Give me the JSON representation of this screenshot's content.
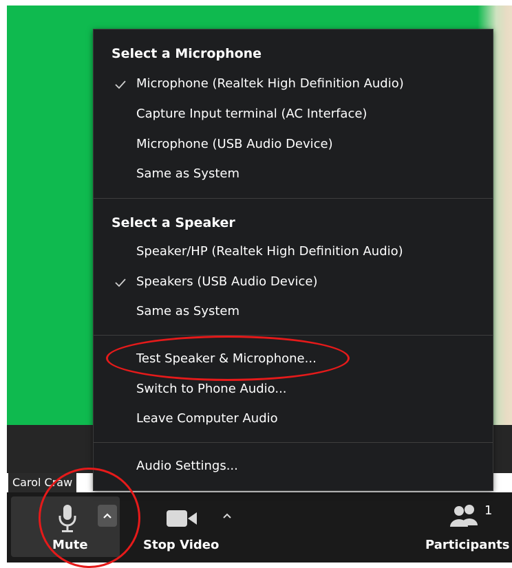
{
  "video": {
    "participant_name": "Carol Craw"
  },
  "menu": {
    "microphone_section": {
      "title": "Select a Microphone",
      "items": [
        {
          "label": "Microphone (Realtek High Definition Audio)",
          "checked": true
        },
        {
          "label": "Capture Input terminal (AC Interface)",
          "checked": false
        },
        {
          "label": "Microphone (USB Audio Device)",
          "checked": false
        },
        {
          "label": "Same as System",
          "checked": false
        }
      ]
    },
    "speaker_section": {
      "title": "Select a Speaker",
      "items": [
        {
          "label": "Speaker/HP (Realtek High Definition Audio)",
          "checked": false
        },
        {
          "label": "Speakers (USB Audio Device)",
          "checked": true
        },
        {
          "label": "Same as System",
          "checked": false
        }
      ]
    },
    "actions": [
      {
        "label": "Test Speaker & Microphone..."
      },
      {
        "label": "Switch to Phone Audio..."
      },
      {
        "label": "Leave Computer Audio"
      }
    ],
    "settings": {
      "label": "Audio Settings..."
    }
  },
  "toolbar": {
    "mute_label": "Mute",
    "stop_video_label": "Stop Video",
    "participants_label": "Participants",
    "participants_count": "1"
  },
  "colors": {
    "video_bg": "#0fba4f",
    "menu_bg": "#1d1e20",
    "toolbar_bg": "#1a1a1a",
    "annotation": "#e51a1a"
  }
}
